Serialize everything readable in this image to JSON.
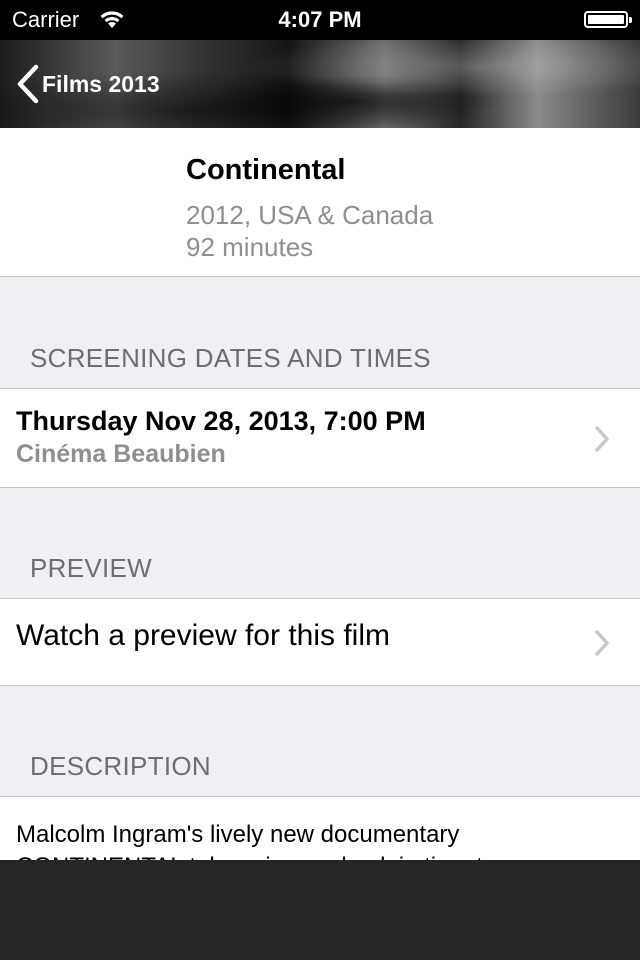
{
  "status": {
    "carrier": "Carrier",
    "time": "4:07 PM"
  },
  "nav": {
    "back_label": "Films 2013"
  },
  "film": {
    "title": "Continental",
    "year_country": "2012, USA & Canada",
    "duration": "92 minutes"
  },
  "sections": {
    "screenings": {
      "header": "SCREENING DATES AND TIMES",
      "items": [
        {
          "datetime": "Thursday Nov 28, 2013, 7:00 PM",
          "venue": "Cinéma Beaubien"
        }
      ]
    },
    "preview": {
      "header": "PREVIEW",
      "label": "Watch a preview for this film"
    },
    "description": {
      "header": "DESCRIPTION",
      "text": "Malcolm Ingram's lively new documentary CONTINENTAL takes viewers back in time to"
    }
  },
  "icons": {
    "wifi": "wifi-icon",
    "battery": "battery-icon",
    "back": "chevron-left-icon",
    "disclosure": "chevron-right-icon"
  },
  "colors": {
    "background": "#efeff4",
    "secondary_text": "#8e8e93",
    "section_header": "#6d6d72",
    "bottom_bar": "#262628"
  }
}
